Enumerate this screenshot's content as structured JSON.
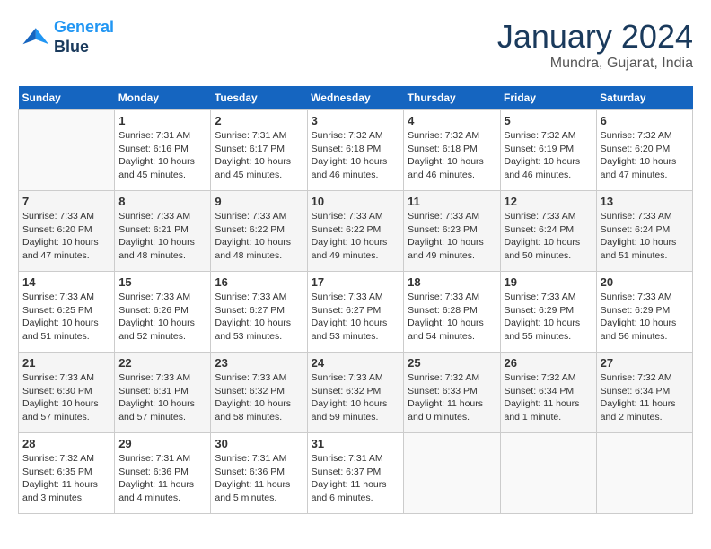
{
  "header": {
    "logo_line1": "General",
    "logo_line2": "Blue",
    "month_title": "January 2024",
    "location": "Mundra, Gujarat, India"
  },
  "weekdays": [
    "Sunday",
    "Monday",
    "Tuesday",
    "Wednesday",
    "Thursday",
    "Friday",
    "Saturday"
  ],
  "weeks": [
    [
      {
        "day": "",
        "info": ""
      },
      {
        "day": "1",
        "info": "Sunrise: 7:31 AM\nSunset: 6:16 PM\nDaylight: 10 hours\nand 45 minutes."
      },
      {
        "day": "2",
        "info": "Sunrise: 7:31 AM\nSunset: 6:17 PM\nDaylight: 10 hours\nand 45 minutes."
      },
      {
        "day": "3",
        "info": "Sunrise: 7:32 AM\nSunset: 6:18 PM\nDaylight: 10 hours\nand 46 minutes."
      },
      {
        "day": "4",
        "info": "Sunrise: 7:32 AM\nSunset: 6:18 PM\nDaylight: 10 hours\nand 46 minutes."
      },
      {
        "day": "5",
        "info": "Sunrise: 7:32 AM\nSunset: 6:19 PM\nDaylight: 10 hours\nand 46 minutes."
      },
      {
        "day": "6",
        "info": "Sunrise: 7:32 AM\nSunset: 6:20 PM\nDaylight: 10 hours\nand 47 minutes."
      }
    ],
    [
      {
        "day": "7",
        "info": "Sunrise: 7:33 AM\nSunset: 6:20 PM\nDaylight: 10 hours\nand 47 minutes."
      },
      {
        "day": "8",
        "info": "Sunrise: 7:33 AM\nSunset: 6:21 PM\nDaylight: 10 hours\nand 48 minutes."
      },
      {
        "day": "9",
        "info": "Sunrise: 7:33 AM\nSunset: 6:22 PM\nDaylight: 10 hours\nand 48 minutes."
      },
      {
        "day": "10",
        "info": "Sunrise: 7:33 AM\nSunset: 6:22 PM\nDaylight: 10 hours\nand 49 minutes."
      },
      {
        "day": "11",
        "info": "Sunrise: 7:33 AM\nSunset: 6:23 PM\nDaylight: 10 hours\nand 49 minutes."
      },
      {
        "day": "12",
        "info": "Sunrise: 7:33 AM\nSunset: 6:24 PM\nDaylight: 10 hours\nand 50 minutes."
      },
      {
        "day": "13",
        "info": "Sunrise: 7:33 AM\nSunset: 6:24 PM\nDaylight: 10 hours\nand 51 minutes."
      }
    ],
    [
      {
        "day": "14",
        "info": "Sunrise: 7:33 AM\nSunset: 6:25 PM\nDaylight: 10 hours\nand 51 minutes."
      },
      {
        "day": "15",
        "info": "Sunrise: 7:33 AM\nSunset: 6:26 PM\nDaylight: 10 hours\nand 52 minutes."
      },
      {
        "day": "16",
        "info": "Sunrise: 7:33 AM\nSunset: 6:27 PM\nDaylight: 10 hours\nand 53 minutes."
      },
      {
        "day": "17",
        "info": "Sunrise: 7:33 AM\nSunset: 6:27 PM\nDaylight: 10 hours\nand 53 minutes."
      },
      {
        "day": "18",
        "info": "Sunrise: 7:33 AM\nSunset: 6:28 PM\nDaylight: 10 hours\nand 54 minutes."
      },
      {
        "day": "19",
        "info": "Sunrise: 7:33 AM\nSunset: 6:29 PM\nDaylight: 10 hours\nand 55 minutes."
      },
      {
        "day": "20",
        "info": "Sunrise: 7:33 AM\nSunset: 6:29 PM\nDaylight: 10 hours\nand 56 minutes."
      }
    ],
    [
      {
        "day": "21",
        "info": "Sunrise: 7:33 AM\nSunset: 6:30 PM\nDaylight: 10 hours\nand 57 minutes."
      },
      {
        "day": "22",
        "info": "Sunrise: 7:33 AM\nSunset: 6:31 PM\nDaylight: 10 hours\nand 57 minutes."
      },
      {
        "day": "23",
        "info": "Sunrise: 7:33 AM\nSunset: 6:32 PM\nDaylight: 10 hours\nand 58 minutes."
      },
      {
        "day": "24",
        "info": "Sunrise: 7:33 AM\nSunset: 6:32 PM\nDaylight: 10 hours\nand 59 minutes."
      },
      {
        "day": "25",
        "info": "Sunrise: 7:32 AM\nSunset: 6:33 PM\nDaylight: 11 hours\nand 0 minutes."
      },
      {
        "day": "26",
        "info": "Sunrise: 7:32 AM\nSunset: 6:34 PM\nDaylight: 11 hours\nand 1 minute."
      },
      {
        "day": "27",
        "info": "Sunrise: 7:32 AM\nSunset: 6:34 PM\nDaylight: 11 hours\nand 2 minutes."
      }
    ],
    [
      {
        "day": "28",
        "info": "Sunrise: 7:32 AM\nSunset: 6:35 PM\nDaylight: 11 hours\nand 3 minutes."
      },
      {
        "day": "29",
        "info": "Sunrise: 7:31 AM\nSunset: 6:36 PM\nDaylight: 11 hours\nand 4 minutes."
      },
      {
        "day": "30",
        "info": "Sunrise: 7:31 AM\nSunset: 6:36 PM\nDaylight: 11 hours\nand 5 minutes."
      },
      {
        "day": "31",
        "info": "Sunrise: 7:31 AM\nSunset: 6:37 PM\nDaylight: 11 hours\nand 6 minutes."
      },
      {
        "day": "",
        "info": ""
      },
      {
        "day": "",
        "info": ""
      },
      {
        "day": "",
        "info": ""
      }
    ]
  ]
}
